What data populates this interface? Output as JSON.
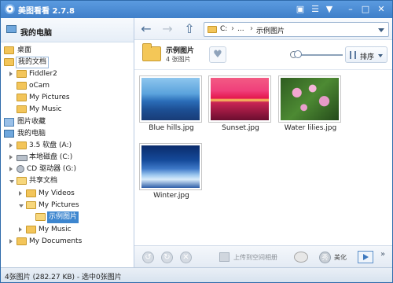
{
  "app": {
    "title": "美图看看 2.7.8"
  },
  "titlebar": {
    "buttons": [
      "chat-icon",
      "menu-icon",
      "shirt-icon",
      "minimize-icon",
      "maximize-icon",
      "close-icon"
    ]
  },
  "sidebar": {
    "header": "我的电脑",
    "tree": [
      {
        "label": "桌面",
        "icon": "folder"
      },
      {
        "label": "我的文档",
        "icon": "folder"
      },
      {
        "label": "Fiddler2",
        "icon": "folder"
      },
      {
        "label": "oCam",
        "icon": "folder"
      },
      {
        "label": "My Pictures",
        "icon": "folder"
      },
      {
        "label": "My Music",
        "icon": "folder"
      },
      {
        "label": "图片收藏",
        "icon": "stars"
      },
      {
        "label": "我的电脑",
        "icon": "computer"
      },
      {
        "label": "3.5 软盘 (A:)",
        "icon": "drive"
      },
      {
        "label": "本地磁盘 (C:)",
        "icon": "drive"
      },
      {
        "label": "CD 驱动器 (G:)",
        "icon": "cd"
      },
      {
        "label": "共享文档",
        "icon": "folder"
      },
      {
        "label": "My Videos",
        "icon": "folder"
      },
      {
        "label": "My Pictures",
        "icon": "folder"
      },
      {
        "label": "示例图片",
        "icon": "folder"
      },
      {
        "label": "My Music",
        "icon": "folder"
      },
      {
        "label": "My Documents",
        "icon": "folder"
      }
    ]
  },
  "toolbar": {
    "address": {
      "drive": "C:",
      "ellipsis": "...",
      "sep": "›",
      "folder": "示例图片"
    }
  },
  "info": {
    "folder_name": "示例图片",
    "count_text": "4 张图片",
    "sort_label": "排序"
  },
  "images": [
    {
      "name": "Blue hills.jpg",
      "style": "img-blue"
    },
    {
      "name": "Sunset.jpg",
      "style": "img-sunset"
    },
    {
      "name": "Water lilies.jpg",
      "style": "img-lilies"
    },
    {
      "name": "Winter.jpg",
      "style": "img-winter"
    }
  ],
  "bottombar": {
    "upload_label": "上传到空间相册",
    "beautify_label": "美化",
    "beautify_icon_text": "秀"
  },
  "status": {
    "text": "4张图片 (282.27 KB) - 选中0张图片"
  }
}
